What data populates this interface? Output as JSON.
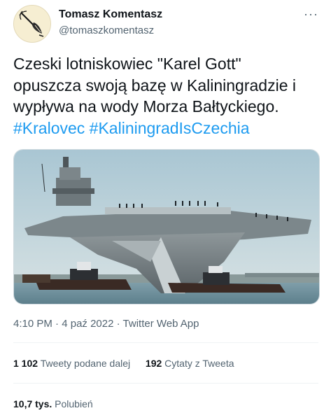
{
  "author": {
    "display_name": "Tomasz Komentasz",
    "handle": "@tomaszkomentasz",
    "avatar_icon": "quill-pen-icon"
  },
  "more_label": "···",
  "tweet": {
    "text_lines": [
      "Czeski lotniskowiec \"Karel Gott\"",
      "opuszcza swoją bazę w Kaliningradzie i",
      "wypływa na wody Morza Bałtyckiego."
    ],
    "hashtags": [
      "#Kralovec",
      "#KaliningradIsCzechia"
    ],
    "hashtag_color": "#1d9bf0"
  },
  "meta": {
    "time": "4:10 PM",
    "dot": "·",
    "date": "4 paź 2022",
    "app": "Twitter Web App"
  },
  "stats": {
    "retweets_count": "1 102",
    "retweets_label": "Tweety podane dalej",
    "quotes_count": "192",
    "quotes_label": "Cytaty z Tweeta",
    "likes_count": "10,7 tys.",
    "likes_label": "Polubień"
  }
}
